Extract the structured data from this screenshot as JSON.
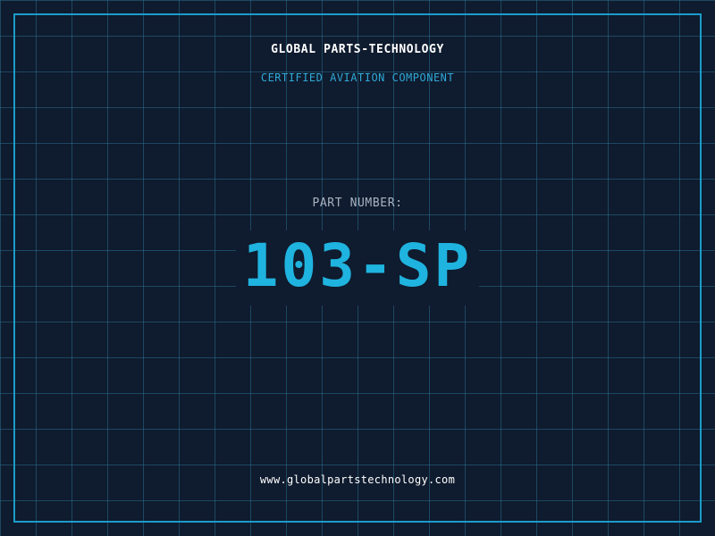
{
  "header": {
    "company": "GLOBAL PARTS-TECHNOLOGY",
    "subtitle": "CERTIFIED AVIATION COMPONENT"
  },
  "part": {
    "label": "PART NUMBER:",
    "number": "103-SP"
  },
  "footer": {
    "url": "www.globalpartstechnology.com"
  },
  "colors": {
    "background": "#0f1b2e",
    "grid": "#286e8c",
    "frame": "#1b9cc9",
    "accent": "#1fb3df",
    "text": "#ffffff",
    "muted": "#a8b4c2"
  }
}
